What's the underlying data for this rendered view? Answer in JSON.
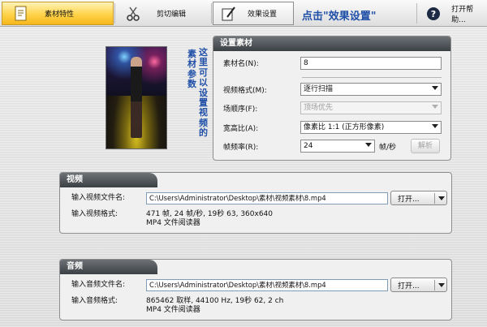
{
  "toolbar": {
    "material_label": "素材特性",
    "cut_label": "剪切编辑",
    "effect_label": "效果设置",
    "help_label": "打开帮助..."
  },
  "annotations": {
    "top": "点击\"效果设置\"",
    "side_right": "这里可以设置视频的",
    "side_left": "素材参数"
  },
  "settings": {
    "title": "设置素材",
    "name_label": "素材名(N):",
    "name_value": "8",
    "video_format_label": "视频格式(M):",
    "video_format_value": "逐行扫描",
    "field_order_label": "场顺序(F):",
    "field_order_value": "顶场优先",
    "aspect_label": "宽高比(A):",
    "aspect_value": "像素比 1:1 (正方形像素)",
    "frame_rate_label": "帧频率(R):",
    "frame_rate_value": "24",
    "frame_rate_unit": "帧/秒",
    "parse_button": "解析"
  },
  "video": {
    "title": "视频",
    "file_label": "输入视频文件名:",
    "file_path": "C:\\Users\\Administrator\\Desktop\\素材\\视频素材\\8.mp4",
    "open_button": "打开...",
    "format_label": "输入视频格式:",
    "format_line1": "471 帧, 24 帧/秒, 19秒 63, 360x640",
    "format_line2": "MP4 文件阅读器"
  },
  "audio": {
    "title": "音频",
    "file_label": "输入音频文件名:",
    "file_path": "C:\\Users\\Administrator\\Desktop\\素材\\视频素材\\8.mp4",
    "open_button": "打开...",
    "format_label": "输入音频格式:",
    "format_line1": "865462 取样, 44100 Hz, 19秒 62, 2 ch",
    "format_line2": "MP4 文件阅读器"
  }
}
